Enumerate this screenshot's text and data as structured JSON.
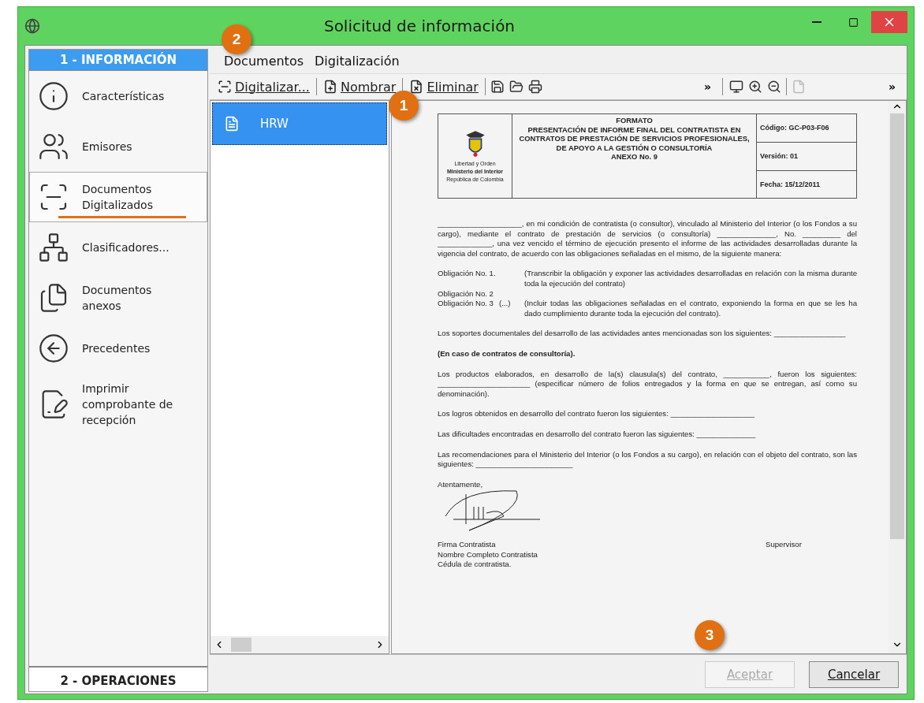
{
  "window": {
    "title": "Solicitud de información"
  },
  "sidebar": {
    "header": "1 - INFORMACIÓN",
    "footer": "2 - OPERACIONES",
    "items": [
      {
        "label": "Características",
        "selected": false
      },
      {
        "label": "Emisores",
        "selected": false
      },
      {
        "label": "Documentos Digitalizados",
        "selected": true
      },
      {
        "label": "Clasificadores...",
        "selected": false
      },
      {
        "label": "Documentos anexos",
        "selected": false
      },
      {
        "label": "Precedentes",
        "selected": false
      },
      {
        "label": "Imprimir comprobante de recepción",
        "selected": false
      }
    ]
  },
  "menu": [
    "Documentos",
    "Digitalización"
  ],
  "toolbar": [
    {
      "kind": "button",
      "label": "Digitalizar..."
    },
    {
      "kind": "separator"
    },
    {
      "kind": "button",
      "label": "Nombrar"
    },
    {
      "kind": "separator"
    },
    {
      "kind": "button",
      "label": "Eliminar"
    },
    {
      "kind": "separator"
    },
    {
      "kind": "icon"
    },
    {
      "kind": "icon"
    },
    {
      "kind": "icon"
    },
    {
      "kind": "more",
      "label": "»"
    }
  ],
  "viewer_toolbar": [
    {
      "kind": "icon",
      "disabled": false
    },
    {
      "kind": "icon",
      "disabled": false
    },
    {
      "kind": "icon",
      "disabled": false
    },
    {
      "kind": "separator"
    },
    {
      "kind": "icon",
      "disabled": true
    },
    {
      "kind": "more",
      "label": "»"
    }
  ],
  "documents": [
    {
      "name": "HRW",
      "selected": true
    }
  ],
  "document": {
    "header": {
      "logo_lines": [
        "Libertad y Orden",
        "Ministerio del Interior",
        "República de Colombia"
      ],
      "title_lines": [
        "FORMATO",
        "PRESENTACIÓN DE INFORME FINAL DEL CONTRATISTA EN CONTRATOS DE PRESTACIÓN DE SERVICIOS PROFESIONALES, DE APOYO A LA GESTIÓN O CONSULTORÍA",
        "ANEXO No. 9"
      ],
      "meta": [
        "Código: GC-P03-F06",
        "Versión: 01",
        "Fecha: 15/12/2011"
      ]
    },
    "intro": "____________________, en mi condición de contratista (o consultor), vinculado al Ministerio del Interior (o los Fondos a su cargo), mediante el contrato de prestación de servicios (o consultoría) ______________, No. _________ del _____________, una vez vencido el término de ejecución presento el informe de las actividades desarrolladas durante la vigencia del contrato, de acuerdo con las obligaciones señaladas en el mismo, de la siguiente manera:",
    "obligations": [
      {
        "label": "Obligación No. 1.",
        "note": "(Transcribir la obligación y exponer las actividades desarrolladas en relación con la misma durante toda la ejecución del contrato)"
      },
      {
        "label": "Obligación No. 2"
      },
      {
        "label": "Obligación No. 3",
        "mark": "(...)",
        "note": "(Incluir todas las obligaciones señaladas en el contrato, exponiendo la forma en que se les ha dado cumplimiento durante toda la ejecución del contrato)."
      }
    ],
    "paragraphs": [
      {
        "kind": "plain",
        "text": "Los soportes documentales del desarrollo de las actividades antes mencionadas son los siguientes: _________________"
      },
      {
        "kind": "bold",
        "text": "(En caso de contratos de consultoría)."
      },
      {
        "kind": "plain",
        "text": "Los productos elaborados, en desarrollo de la(s) clausula(s) del contrato, ___________, fueron los siguientes: ______________________ (especificar número de folios entregados y la forma en que se entregan, así como su denominación)."
      },
      {
        "kind": "plain",
        "text": "Los logros obtenidos en desarrollo del contrato fueron los siguientes: ____________________"
      },
      {
        "kind": "plain",
        "text": "Las dificultades encontradas en desarrollo del contrato fueron las siguientes: ______________"
      },
      {
        "kind": "plain",
        "text": "Las recomendaciones para el Ministerio del Interior (o los Fondos a su cargo), en relación con el objeto del contrato, son las siguientes: _______________________"
      }
    ],
    "closing": "Atentamente,",
    "signature_lines": [
      "Firma Contratista",
      "Nombre Completo Contratista",
      "Cédula de contratista."
    ],
    "supervisor": "Supervisor"
  },
  "buttons": [
    {
      "label": "Aceptar",
      "disabled": true
    },
    {
      "label": "Cancelar",
      "disabled": false
    }
  ],
  "callouts": [
    "2",
    "1",
    "3"
  ]
}
